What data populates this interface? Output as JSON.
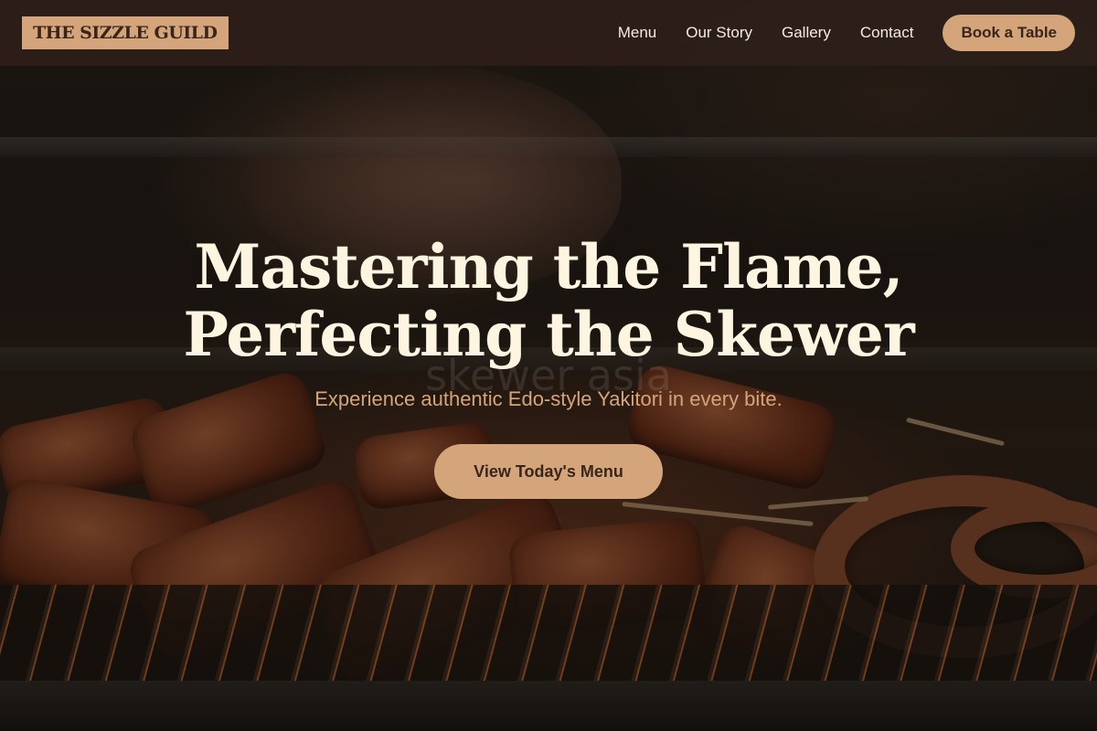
{
  "brand": {
    "name": "THE SIZZLE GUILD"
  },
  "nav": {
    "links": [
      "Menu",
      "Our Story",
      "Gallery",
      "Contact"
    ],
    "cta_label": "Book a Table"
  },
  "hero": {
    "title_line1": "Mastering the Flame,",
    "title_line2": "Perfecting the Skewer",
    "watermark": "skewer asia",
    "subtitle": "Experience authentic Edo-style Yakitori in every bite.",
    "cta_label": "View Today's Menu",
    "background_image": "grilled-skewers-photo"
  },
  "colors": {
    "accent": "#d4a57a",
    "nav_bg": "#2d1e19",
    "title": "#fdf5e0",
    "button_text": "#3a251a"
  }
}
